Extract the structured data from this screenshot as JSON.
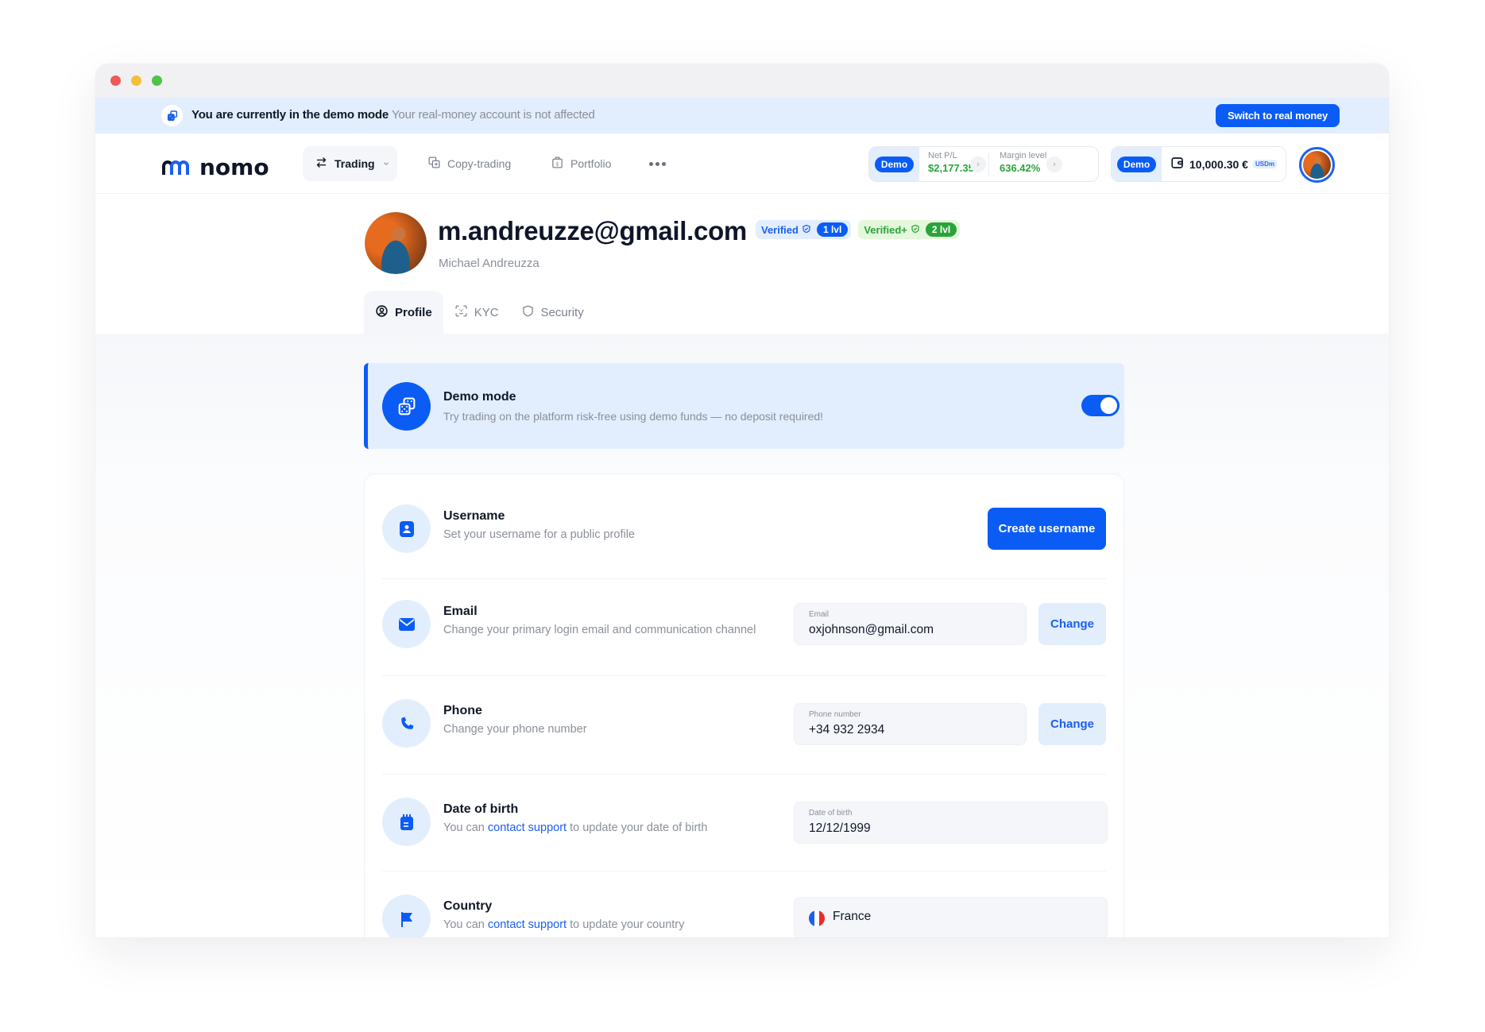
{
  "colors": {
    "accent": "#0a5cf5",
    "positive": "#2ba33a",
    "banner_bg": "#e2eefd"
  },
  "demo_strip": {
    "icon": "dice-icon",
    "title": "You are currently in the demo mode",
    "subtitle": "Your real-money account is not affected",
    "switch_label": "Switch to real money"
  },
  "header": {
    "logo_text": "nomo",
    "nav": [
      {
        "label": "Trading",
        "icon": "swap-arrows-icon",
        "active": true,
        "has_dropdown": true
      },
      {
        "label": "Copy-trading",
        "icon": "copy-icon"
      },
      {
        "label": "Portfolio",
        "icon": "briefcase-dollar-icon"
      }
    ],
    "more_icon": "more-dots-icon",
    "pl_widget": {
      "badge": "Demo",
      "net_pl_label": "Net P/L",
      "net_pl_value": "$2,177.35",
      "margin_label": "Margin level",
      "margin_value": "636.42%"
    },
    "wallet": {
      "badge": "Demo",
      "amount": "10,000.30 €",
      "currency_tag": "USDm"
    }
  },
  "profile": {
    "email": "m.andreuzze@gmail.com",
    "name": "Michael Andreuzza",
    "badges": [
      {
        "label": "Verified",
        "level": "1 lvl",
        "color": "blue"
      },
      {
        "label": "Verified+",
        "level": "2 lvl",
        "color": "green"
      }
    ]
  },
  "tabs": [
    {
      "label": "Profile",
      "icon": "user-circle-icon",
      "active": true
    },
    {
      "label": "KYC",
      "icon": "face-scan-icon",
      "active": false
    },
    {
      "label": "Security",
      "icon": "shield-icon",
      "active": false
    }
  ],
  "demo_mode": {
    "title": "Demo mode",
    "description": "Try trading on the platform risk-free using demo funds — no deposit required!",
    "enabled": true
  },
  "settings": {
    "username": {
      "title": "Username",
      "description": "Set your username for a public profile",
      "button": "Create username"
    },
    "email": {
      "title": "Email",
      "description": "Change your primary login email and communication channel",
      "field_label": "Email",
      "field_value": "oxjohnson@gmail.com",
      "button": "Change"
    },
    "phone": {
      "title": "Phone",
      "description": "Change your phone number",
      "field_label": "Phone number",
      "field_value": "+34 932 2934",
      "button": "Change"
    },
    "dob": {
      "title": "Date of birth",
      "desc_prefix": "You can ",
      "desc_link": "contact support",
      "desc_suffix": " to update your date of birth",
      "field_label": "Date of birth",
      "field_value": "12/12/1999"
    },
    "country": {
      "title": "Country",
      "desc_prefix": "You can ",
      "desc_link": "contact support",
      "desc_suffix": " to update your country",
      "field_value": "France"
    }
  }
}
